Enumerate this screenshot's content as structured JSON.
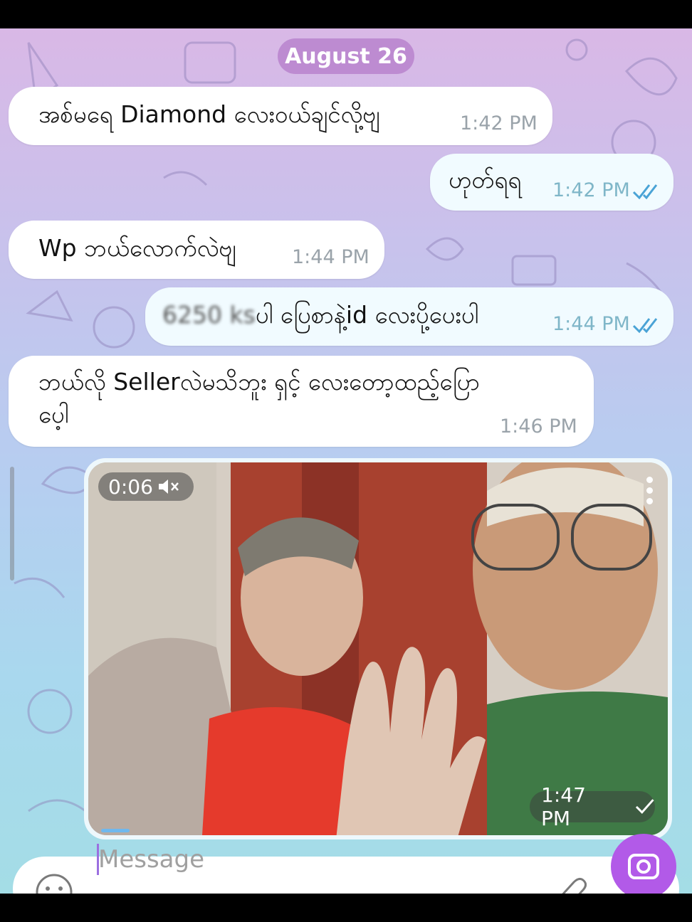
{
  "date_header": "August 26",
  "messages": [
    {
      "direction": "in",
      "text": "အစ်မရေ Diamond လေးဝယ်ချင်လို့ဗျ",
      "time": "1:42 PM"
    },
    {
      "direction": "out",
      "text": "ဟုတ်ရရ",
      "time": "1:42 PM",
      "status": "read"
    },
    {
      "direction": "in",
      "text": "Wp ဘယ်လောက်လဲဗျ",
      "time": "1:44 PM"
    },
    {
      "direction": "out",
      "text_hidden": "6250 ks",
      "text": "ပါ ပြေစာနဲ့id လေးပို့ပေးပါ",
      "time": "1:44 PM",
      "status": "read"
    },
    {
      "direction": "in",
      "text_line1": "ဘယ်လို Sellerလဲမသိဘူး ရှင့် လေးတော့ထည့်ပြော",
      "text_line2": "ပေ့ါ",
      "time": "1:46 PM"
    }
  ],
  "video": {
    "duration": "0:06",
    "muted_icon": "speaker-muted-icon",
    "time": "1:47 PM",
    "status": "sent"
  },
  "composer": {
    "placeholder": "Message"
  },
  "colors": {
    "accent": "#b25ae8",
    "date_pill": "#b982cd",
    "ticks": "#4aa3d6"
  }
}
